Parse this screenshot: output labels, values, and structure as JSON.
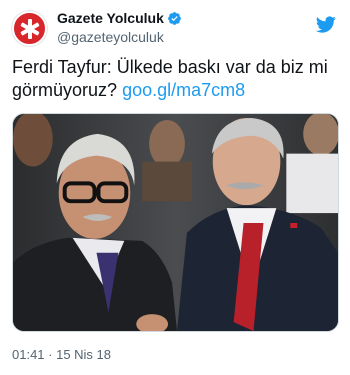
{
  "account": {
    "display_name": "Gazete Yolculuk",
    "handle": "@gazeteyolculuk",
    "verified": true,
    "avatar_icon": "white-star-on-red-circle-logo",
    "brand_color": "#d8262d"
  },
  "tweet": {
    "text": "Ferdi Tayfur: Ülkede baskı var da biz mi görmüyoruz?",
    "link": "goo.gl/ma7cm8",
    "timestamp": "01:41 · 15 Nis 18"
  },
  "media": {
    "type": "photo"
  },
  "colors": {
    "link": "#1d9bf0",
    "verified": "#1d9bf0",
    "secondary_text": "#536471",
    "bird_icon": "#1d9bf0"
  }
}
